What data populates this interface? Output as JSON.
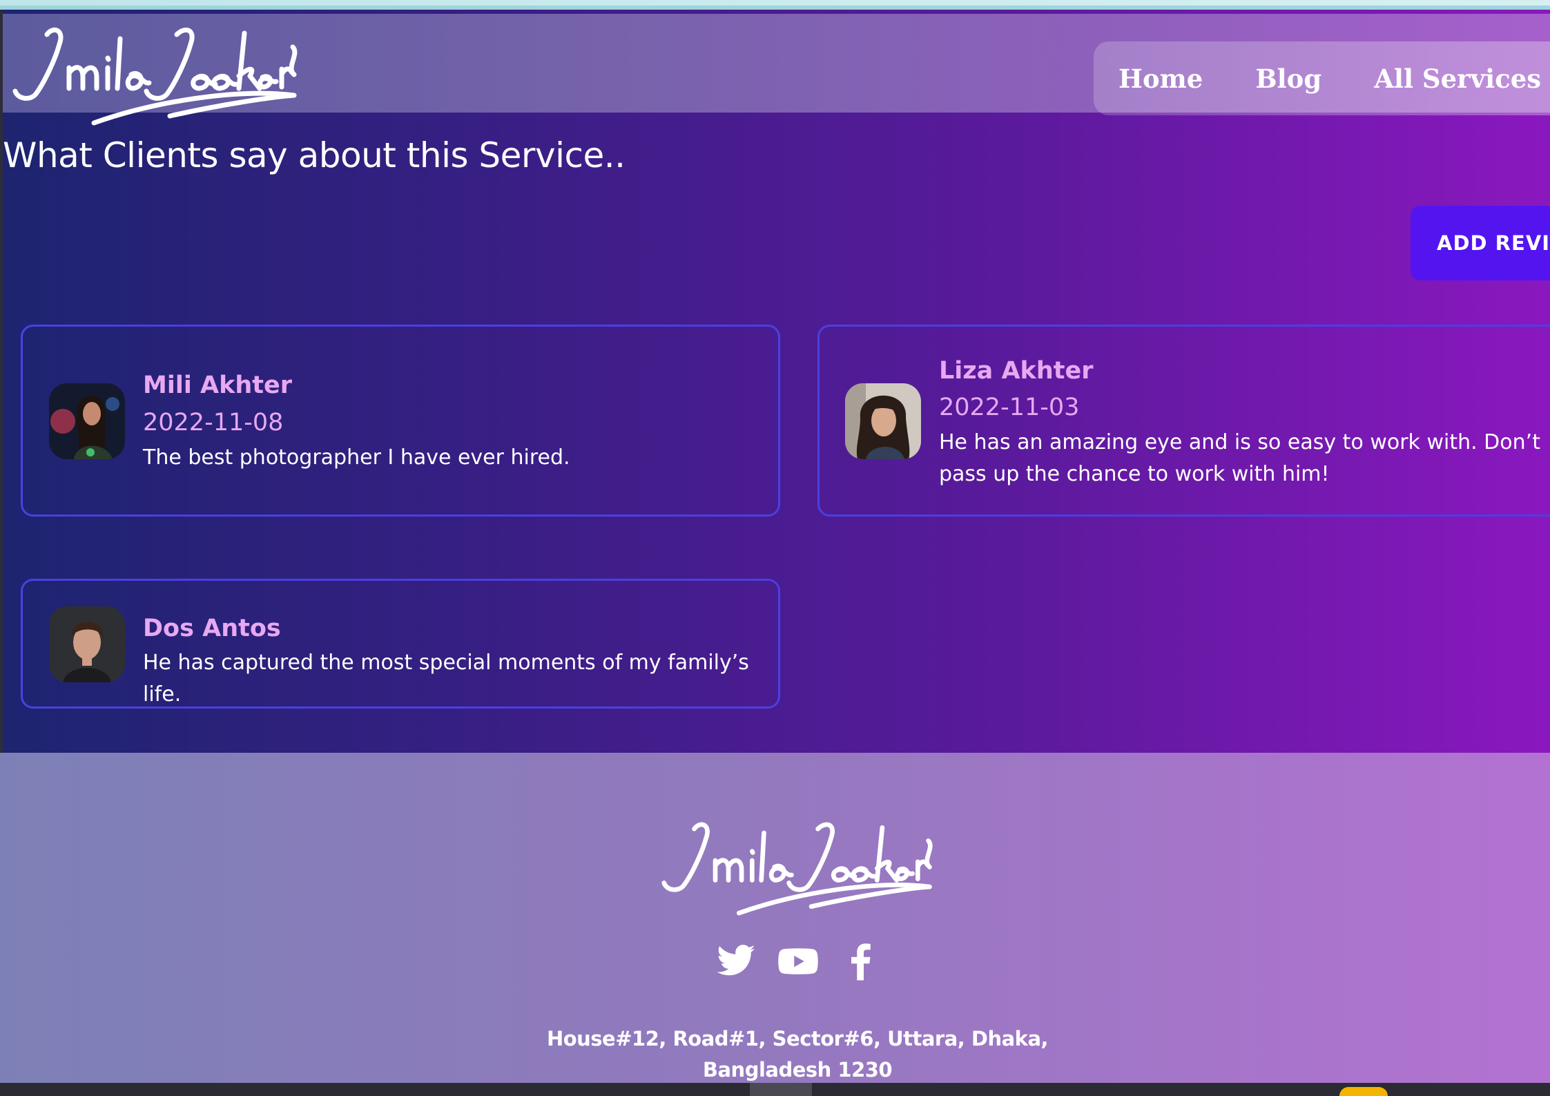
{
  "nav": {
    "items": [
      "Home",
      "Blog",
      "All Services"
    ]
  },
  "reviews": {
    "title": "What Clients say about this Service..",
    "add_button": "ADD REVIEW",
    "items": [
      {
        "name": "Mili Akhter",
        "date": "2022-11-08",
        "text": "The best photographer I have ever hired."
      },
      {
        "name": "Liza Akhter",
        "date": "2022-11-03",
        "text": "He has an amazing eye and is so easy to work with. Don’t pass up the chance to work with him!"
      },
      {
        "name": "Dos Antos",
        "date": "",
        "text": "He has captured the most special moments of my family’s life."
      }
    ]
  },
  "footer": {
    "address_line1": "House#12, Road#1, Sector#6, Uttara, Dhaka,",
    "address_line2": "Bangladesh 1230",
    "social_icons": [
      "twitter-icon",
      "youtube-icon",
      "facebook-icon"
    ]
  },
  "colors": {
    "accent_button": "#5314f0",
    "name_color": "#e8a8f2",
    "card_border": "#4a40e0"
  }
}
